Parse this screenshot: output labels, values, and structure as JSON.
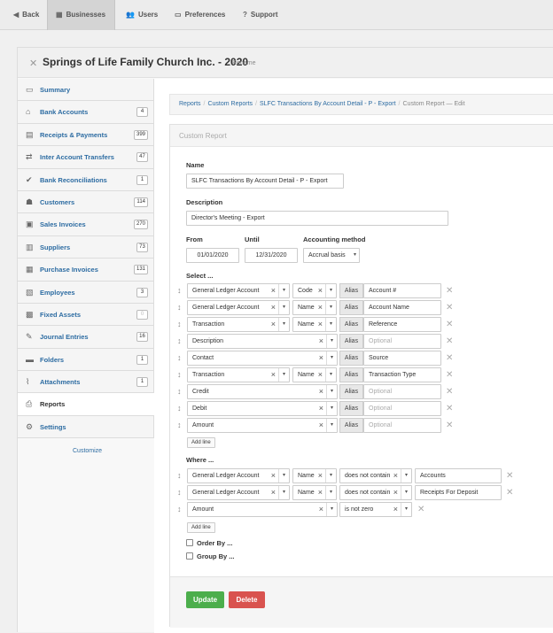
{
  "nav": {
    "back": "Back",
    "businesses": "Businesses",
    "users": "Users",
    "preferences": "Preferences",
    "support": "Support"
  },
  "business": {
    "title": "Springs of Life Family Church Inc. - 2020",
    "rename": "Rename"
  },
  "sidebar": {
    "items": [
      {
        "label": "Summary",
        "icon": "monitor-icon",
        "badge": ""
      },
      {
        "label": "Bank Accounts",
        "icon": "bank-icon",
        "badge": "4"
      },
      {
        "label": "Receipts & Payments",
        "icon": "receipts-icon",
        "badge": "399"
      },
      {
        "label": "Inter Account Transfers",
        "icon": "transfer-icon",
        "badge": "47"
      },
      {
        "label": "Bank Reconciliations",
        "icon": "check-icon",
        "badge": "1"
      },
      {
        "label": "Customers",
        "icon": "customers-icon",
        "badge": "114"
      },
      {
        "label": "Sales Invoices",
        "icon": "inbox-icon",
        "badge": "270"
      },
      {
        "label": "Suppliers",
        "icon": "suppliers-icon",
        "badge": "73"
      },
      {
        "label": "Purchase Invoices",
        "icon": "calendar-icon",
        "badge": "131"
      },
      {
        "label": "Employees",
        "icon": "briefcase-icon",
        "badge": "3"
      },
      {
        "label": "Fixed Assets",
        "icon": "grid-icon",
        "badge": "0"
      },
      {
        "label": "Journal Entries",
        "icon": "pen-icon",
        "badge": "16"
      },
      {
        "label": "Folders",
        "icon": "folder-icon",
        "badge": "1"
      },
      {
        "label": "Attachments",
        "icon": "paperclip-icon",
        "badge": "1"
      },
      {
        "label": "Reports",
        "icon": "printer-icon",
        "badge": ""
      },
      {
        "label": "Settings",
        "icon": "gears-icon",
        "badge": ""
      }
    ],
    "customize": "Customize"
  },
  "breadcrumb": {
    "reports": "Reports",
    "custom_reports": "Custom Reports",
    "report": "SLFC Transactions By Account Detail - P - Export",
    "current": "Custom Report — Edit"
  },
  "form": {
    "panel_title": "Custom Report",
    "name_label": "Name",
    "name_value": "SLFC Transactions By Account Detail - P - Export",
    "description_label": "Description",
    "description_value": "Director's Meeting - Export",
    "from_label": "From",
    "from_value": "01/01/2020",
    "until_label": "Until",
    "until_value": "12/31/2020",
    "method_label": "Accounting method",
    "method_value": "Accrual basis",
    "select_label": "Select ...",
    "alias_label": "Alias",
    "alias_placeholder": "Optional",
    "add_line": "Add line",
    "select_rows": [
      {
        "field": "General Ledger Account",
        "sub": "Code",
        "alias": "Account #"
      },
      {
        "field": "General Ledger Account",
        "sub": "Name",
        "alias": "Account Name"
      },
      {
        "field": "Transaction",
        "sub": "Name",
        "alias": "Reference"
      },
      {
        "field": "Description",
        "sub": "",
        "alias": ""
      },
      {
        "field": "Contact",
        "sub": "",
        "alias": "Source"
      },
      {
        "field": "Transaction",
        "sub": "Name",
        "alias": "Transaction Type"
      },
      {
        "field": "Credit",
        "sub": "",
        "alias": ""
      },
      {
        "field": "Debit",
        "sub": "",
        "alias": ""
      },
      {
        "field": "Amount",
        "sub": "",
        "alias": ""
      }
    ],
    "where_label": "Where ...",
    "where_rows": [
      {
        "field": "General Ledger Account",
        "sub": "Name",
        "op": "does not contain",
        "value": "Accounts"
      },
      {
        "field": "General Ledger Account",
        "sub": "Name",
        "op": "does not contain",
        "value": "Receipts For Deposit"
      },
      {
        "field": "Amount",
        "sub": "",
        "op": "is not zero",
        "value": ""
      }
    ],
    "order_by": "Order By ...",
    "group_by": "Group By ...",
    "update": "Update",
    "delete": "Delete"
  },
  "colors": {
    "link": "#2d6ca2",
    "update": "#4cae4c",
    "delete": "#d9534f"
  }
}
